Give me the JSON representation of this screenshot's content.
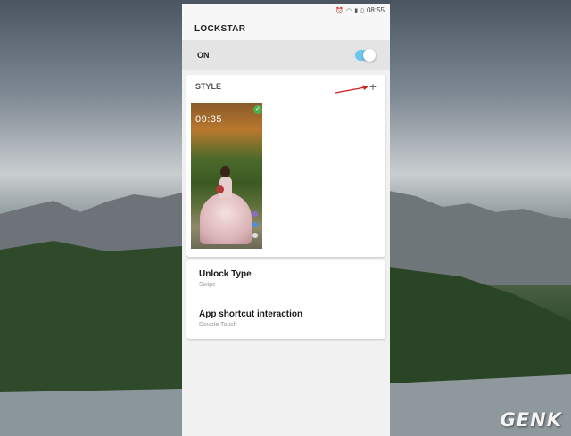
{
  "status_bar": {
    "time": "08:55",
    "icons": [
      "alarm-icon",
      "wifi-icon",
      "signal-icon",
      "battery-icon"
    ]
  },
  "app": {
    "title": "LOCKSTAR"
  },
  "master_switch": {
    "label": "ON",
    "state": true
  },
  "style_section": {
    "label": "STYLE",
    "add_glyph": "+",
    "thumbnail": {
      "clock_text": "09:35",
      "selected": true
    }
  },
  "settings": [
    {
      "title": "Unlock Type",
      "subtitle": "Swipe"
    },
    {
      "title": "App shortcut interaction",
      "subtitle": "Double Touch"
    }
  ],
  "watermark": {
    "text": "GENK"
  },
  "colors": {
    "toggle_on": "#6ec6ee",
    "annotation_arrow": "#d32020",
    "check": "#4caf50"
  }
}
